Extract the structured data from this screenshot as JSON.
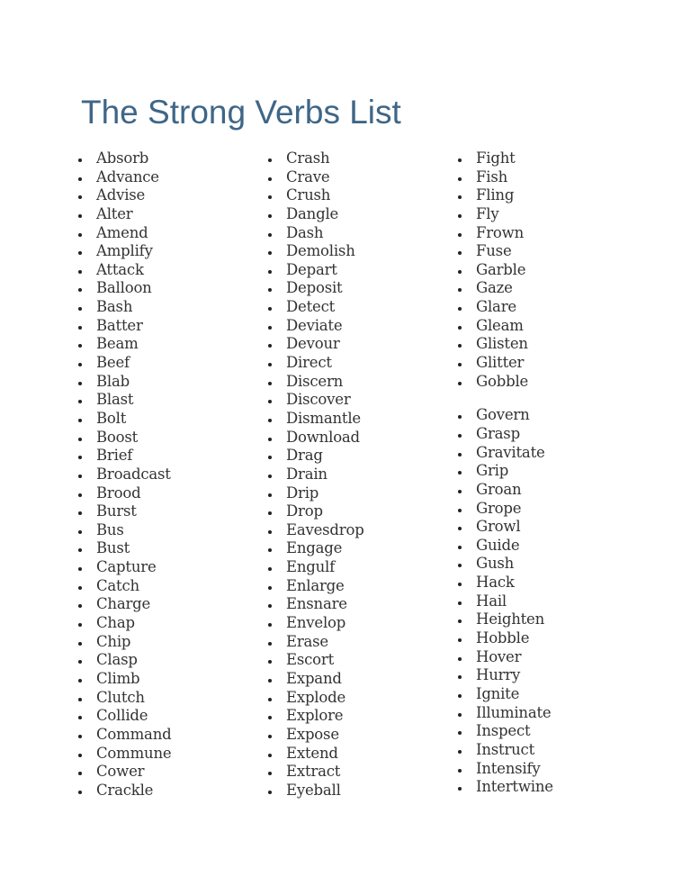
{
  "title": "The Strong Verbs List",
  "colors": {
    "title": "#3f6687",
    "text": "#333333"
  },
  "columns": [
    [
      "Absorb",
      "Advance",
      "Advise",
      "Alter",
      "Amend",
      "Amplify",
      "Attack",
      "Balloon",
      "Bash",
      "Batter",
      "Beam",
      "Beef",
      "Blab",
      "Blast",
      "Bolt",
      "Boost",
      "Brief",
      "Broadcast",
      "Brood",
      "Burst",
      "Bus",
      "Bust",
      "Capture",
      "Catch",
      "Charge",
      "Chap",
      "Chip",
      "Clasp",
      "Climb",
      "Clutch",
      "Collide",
      "Command",
      "Commune",
      "Cower",
      "Crackle"
    ],
    [
      "Crash",
      "Crave",
      "Crush",
      "Dangle",
      "Dash",
      "Demolish",
      "Depart",
      "Deposit",
      "Detect",
      "Deviate",
      "Devour",
      "Direct",
      "Discern",
      "Discover",
      "Dismantle",
      "Download",
      "Drag",
      "Drain",
      "Drip",
      "Drop",
      "Eavesdrop",
      "Engage",
      "Engulf",
      "Enlarge",
      "Ensnare",
      "Envelop",
      "Erase",
      "Escort",
      "Expand",
      "Explode",
      "Explore",
      "Expose",
      "Extend",
      "Extract",
      "Eyeball"
    ],
    [
      "Fight",
      "Fish",
      "Fling",
      "Fly",
      "Frown",
      "Fuse",
      "Garble",
      "Gaze",
      "Glare",
      "Gleam",
      "Glisten",
      "Glitter",
      "Gobble",
      "",
      "Govern",
      "Grasp",
      "Gravitate",
      "Grip",
      "Groan",
      "Grope",
      "Growl",
      "Guide",
      "Gush",
      "Hack",
      "Hail",
      "Heighten",
      "Hobble",
      "Hover",
      "Hurry",
      "Ignite",
      "Illuminate",
      "Inspect",
      "Instruct",
      "Intensify",
      "Intertwine"
    ]
  ]
}
